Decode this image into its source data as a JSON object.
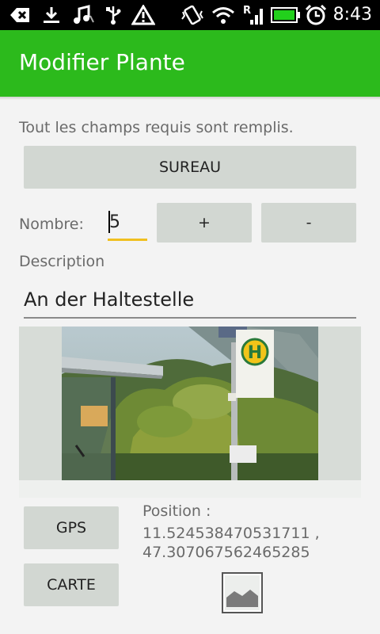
{
  "status_bar": {
    "time": "8:43",
    "icons": [
      "usb-debug-icon",
      "download-icon",
      "music-icon",
      "usb-icon",
      "warning-icon",
      "vibrate-icon",
      "wifi-icon",
      "signal-roaming-icon",
      "battery-icon",
      "alarm-icon"
    ],
    "roaming_letter": "R"
  },
  "action_bar": {
    "title": "Modifier Plante"
  },
  "form": {
    "status_message": "Tout les champs requis sont remplis.",
    "species_button": "SUREAU",
    "count_label": "Nombre:",
    "count_value": "5",
    "plus_label": "+",
    "minus_label": "-",
    "description_label": "Description",
    "description_value": "An der Haltestelle"
  },
  "location": {
    "gps_button": "GPS",
    "map_button": "CARTE",
    "position_label": "Position :",
    "position_line1": "11.524538470531711 ,",
    "position_line2": "47.307067562465285"
  },
  "photo": {
    "sign_letter": "H"
  },
  "colors": {
    "action_bar": "#2cba1c",
    "button_bg": "#d2d7d2",
    "focus_underline": "#f0c020",
    "background": "#f3f3f3"
  }
}
